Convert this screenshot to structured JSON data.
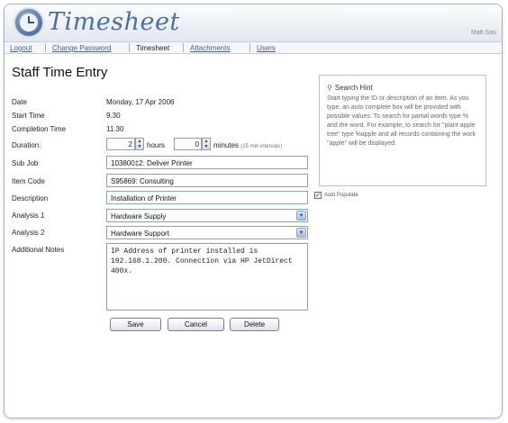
{
  "app": {
    "title": "Timesheet",
    "user": "Matt Sou"
  },
  "nav": [
    {
      "label": "Logout",
      "active": false
    },
    {
      "label": "Change Password",
      "active": false
    },
    {
      "label": "Timesheet",
      "active": true
    },
    {
      "label": "Attachments",
      "active": false
    },
    {
      "label": "Users",
      "active": false
    }
  ],
  "page": {
    "title": "Staff Time Entry"
  },
  "form": {
    "date": {
      "label": "Date",
      "value": "Monday, 17 Apr 2006"
    },
    "start_time": {
      "label": "Start Time",
      "value": "9.30"
    },
    "completion_time": {
      "label": "Completion Time",
      "value": "11.30"
    },
    "duration": {
      "label": "Duration:",
      "hours_value": "2",
      "hours_label": "hours",
      "minutes_value": "0",
      "minutes_label": "minutes",
      "interval_note": "(15 min intervals)"
    },
    "sub_job": {
      "label": "Sub Job",
      "value": "103800‡2: Deliver Printer"
    },
    "item_code": {
      "label": "Item Code",
      "value": "S95869: Consulting"
    },
    "description": {
      "label": "Description",
      "value": "Installation of Printer"
    },
    "analysis1": {
      "label": "Analysis 1",
      "value": "Hardware Supply"
    },
    "analysis2": {
      "label": "Analysis 2",
      "value": "Hardware Support"
    },
    "notes": {
      "label": "Additional Notes",
      "value": "IP Address of printer installed is 192.168.1.200. Connection via HP JetDirect 400x."
    }
  },
  "buttons": {
    "save": "Save",
    "cancel": "Cancel",
    "delete": "Delete"
  },
  "hint": {
    "title": "Search Hint",
    "text": "Start typing the ID or description of an item. As you type, an auto complete box will be provided with possible values. To search for partial words type % and the word. For example, to search for \"plant apple tree\" type %apple and all records containing the work \"apple\" will be displayed."
  },
  "auto_populate": {
    "label": "Auto Populate",
    "checked": true
  }
}
